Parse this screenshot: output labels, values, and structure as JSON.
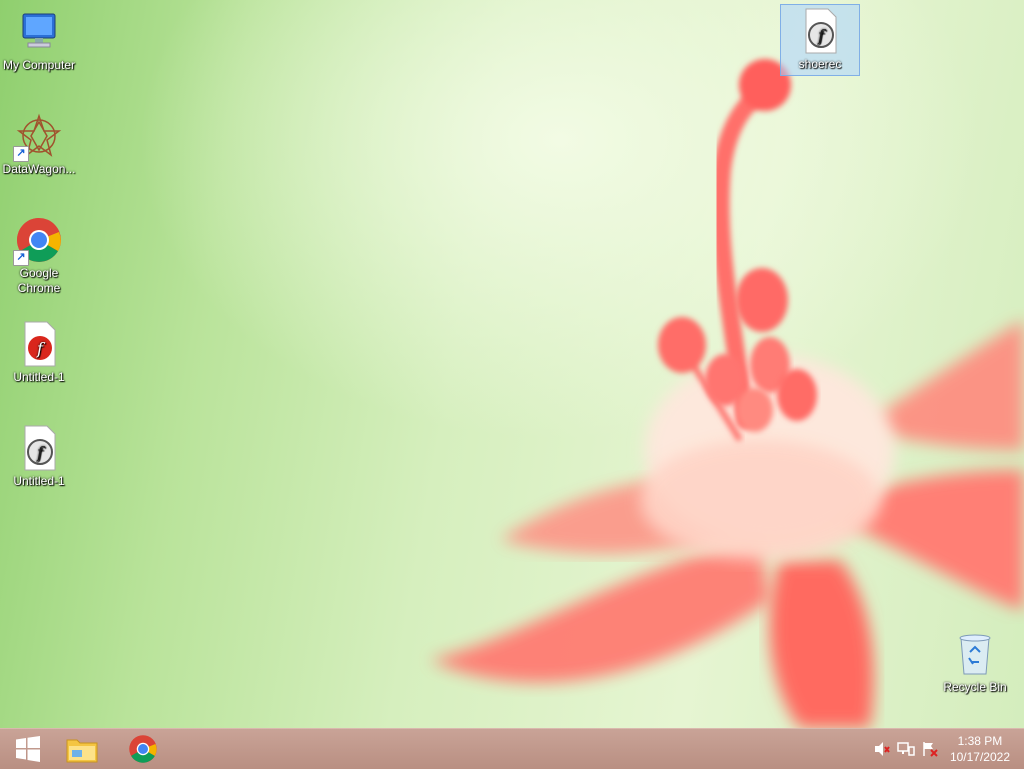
{
  "desktop": {
    "icons": [
      {
        "label": "My Computer",
        "icon": "computer-icon"
      },
      {
        "label": "DataWagon...",
        "icon": "datawagon-icon",
        "shortcut": true
      },
      {
        "label": "Google Chrome",
        "icon": "chrome-icon",
        "shortcut": true
      },
      {
        "label": "Untitled-1",
        "icon": "flash-red-file-icon"
      },
      {
        "label": "Untitled-1",
        "icon": "flash-file-icon"
      },
      {
        "label": "shoerec",
        "icon": "flash-file-icon",
        "selected": true
      },
      {
        "label": "Recycle Bin",
        "icon": "recycle-bin-icon"
      }
    ]
  },
  "taskbar": {
    "start": "start-button",
    "pinned": [
      "file-explorer-icon",
      "chrome-icon"
    ],
    "tray": [
      "volume-muted-icon",
      "network-icon",
      "action-center-icon"
    ],
    "clock": {
      "time": "1:38 PM",
      "date": "10/17/2022"
    }
  },
  "colors": {
    "taskbar": "#bf9588",
    "selection": "#aad2ff"
  }
}
